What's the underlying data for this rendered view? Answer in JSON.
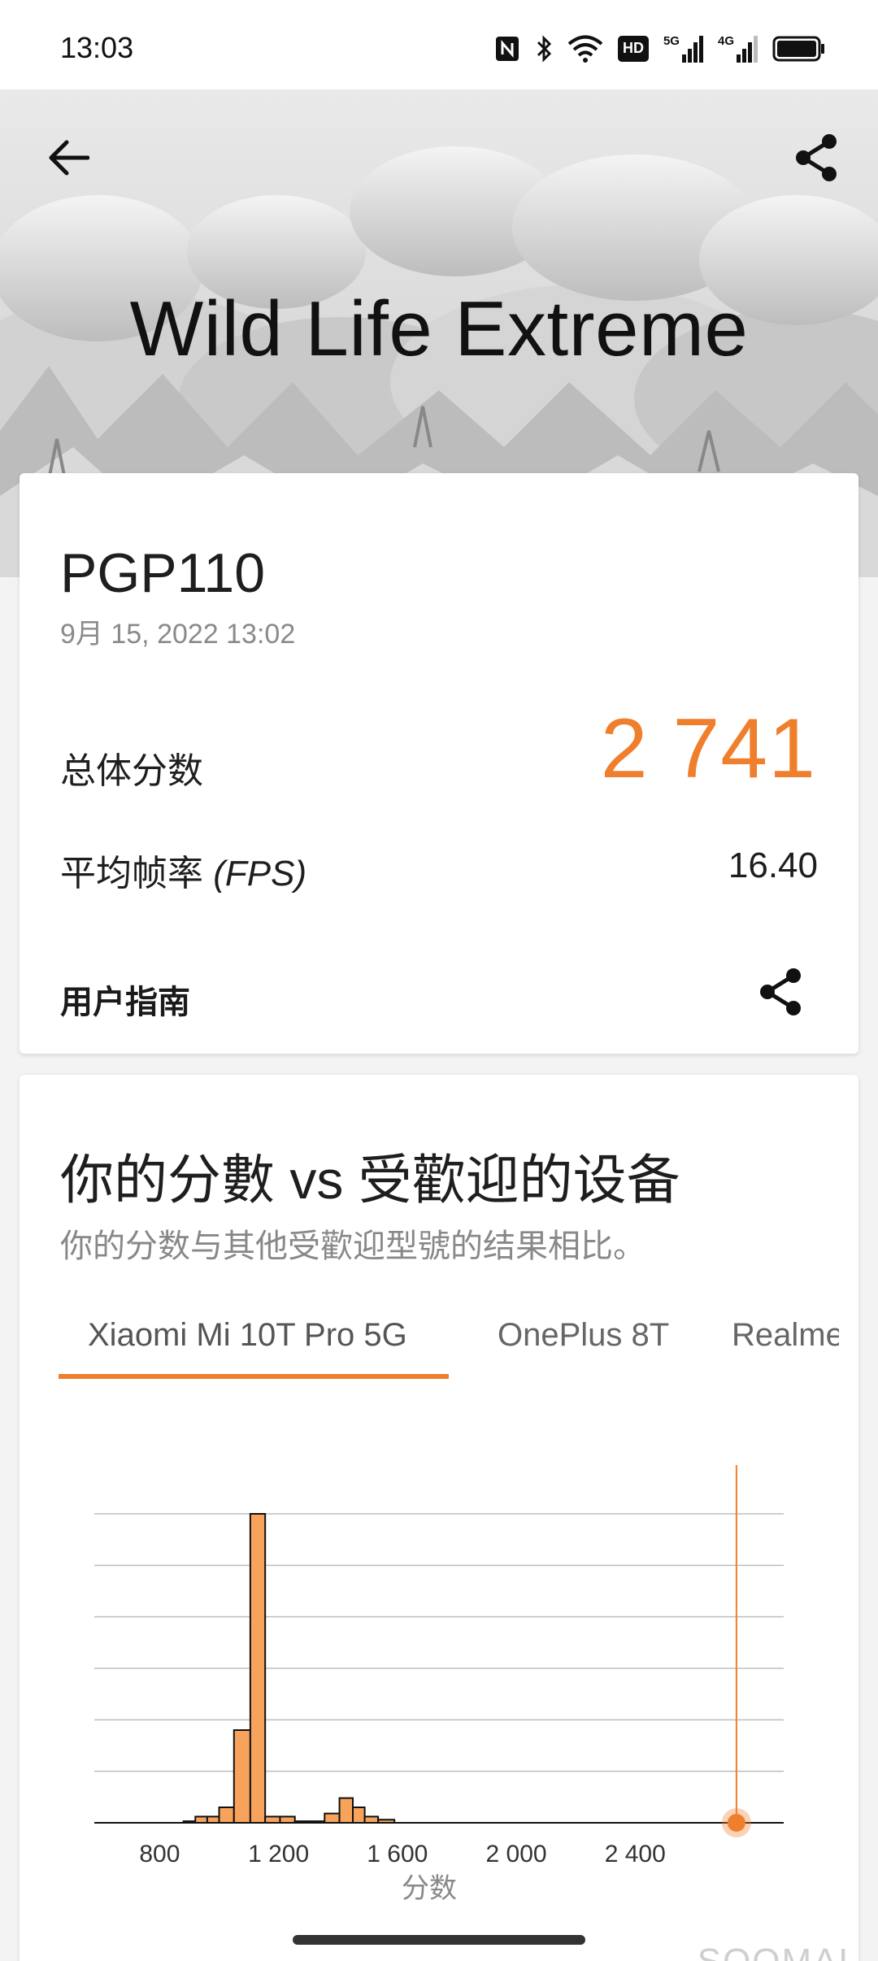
{
  "status_bar": {
    "time": "13:03",
    "icons": [
      "nfc-icon",
      "bluetooth-icon",
      "wifi-icon",
      "hd-icon",
      "signal-5g-icon",
      "signal-4g-icon",
      "battery-icon"
    ],
    "hd_label": "HD",
    "net1_label": "5G",
    "net2_label": "4G"
  },
  "header": {
    "title": "Wild Life Extreme",
    "back_icon": "arrow-left-icon",
    "share_icon": "share-icon"
  },
  "result": {
    "device": "PGP110",
    "date": "9月 15, 2022 13:02",
    "overall_label": "总体分数",
    "overall_score": "2 741",
    "fps_label": "平均帧率",
    "fps_label_suffix": "(FPS)",
    "fps_value": "16.40",
    "guide_label": "用户指南"
  },
  "comparison": {
    "title": "你的分數 vs 受歡迎的设备",
    "subtitle": "你的分数与其他受歡迎型號的结果相比。",
    "tabs": [
      "Xiaomi Mi 10T Pro 5G",
      "OnePlus 8T",
      "Realme"
    ],
    "active_tab": 0
  },
  "chart_data": {
    "type": "bar",
    "xlabel": "分数",
    "ylabel": "",
    "xlim": [
      580,
      2900
    ],
    "x_ticks": [
      800,
      1200,
      1600,
      2000,
      2400
    ],
    "x_tick_labels": [
      "800",
      "1 200",
      "1 600",
      "2 000",
      "2 400"
    ],
    "grid": true,
    "bins": [
      {
        "x": 620,
        "y": 0
      },
      {
        "x": 700,
        "y": 0
      },
      {
        "x": 780,
        "y": 0
      },
      {
        "x": 860,
        "y": 0
      },
      {
        "x": 900,
        "y": 0.5
      },
      {
        "x": 940,
        "y": 2
      },
      {
        "x": 980,
        "y": 2
      },
      {
        "x": 1020,
        "y": 5
      },
      {
        "x": 1080,
        "y": 30
      },
      {
        "x": 1130,
        "y": 100
      },
      {
        "x": 1180,
        "y": 2
      },
      {
        "x": 1230,
        "y": 2
      },
      {
        "x": 1280,
        "y": 0.5
      },
      {
        "x": 1330,
        "y": 0.5
      },
      {
        "x": 1380,
        "y": 3
      },
      {
        "x": 1430,
        "y": 8
      },
      {
        "x": 1470,
        "y": 5
      },
      {
        "x": 1510,
        "y": 2
      },
      {
        "x": 1560,
        "y": 1
      },
      {
        "x": 1620,
        "y": 0
      }
    ],
    "your_score": 2741,
    "accent_color": "#f07f2d",
    "bar_color": "#f7a35c"
  },
  "watermark": "SOOMAL",
  "colors": {
    "accent": "#f07f2d"
  }
}
